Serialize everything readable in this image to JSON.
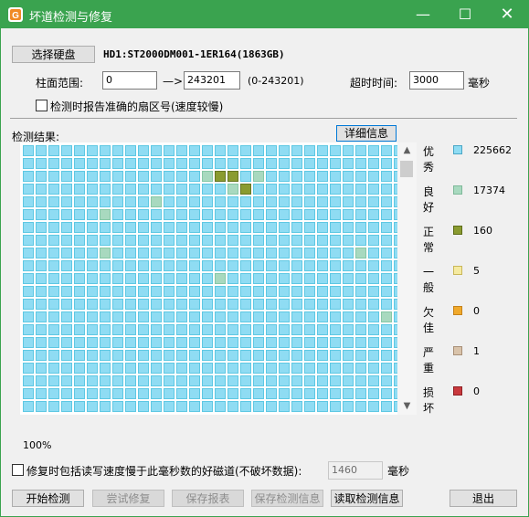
{
  "window": {
    "title": "坏道检测与修复",
    "minimize": "—",
    "maximize": "☐",
    "close": "✕"
  },
  "select_disk_button": "选择硬盘",
  "disk_info": "HD1:ST2000DM001-1ER164(1863GB)",
  "range": {
    "label": "柱面范围:",
    "start": "0",
    "arrow": "—>",
    "end": "243201",
    "hint": "(0-243201)"
  },
  "timeout": {
    "label": "超时时间:",
    "value": "3000",
    "unit": "毫秒"
  },
  "report_sector_checkbox": "检测时报告准确的扇区号(速度较慢)",
  "results_label": "检测结果:",
  "details_button": "详细信息",
  "legend": [
    {
      "label": "优秀",
      "count": "225662",
      "color": "#8fdcf3"
    },
    {
      "label": "良好",
      "count": "17374",
      "color": "#a8d9bf"
    },
    {
      "label": "正常",
      "count": "160",
      "color": "#8a9b30"
    },
    {
      "label": "一般",
      "count": "5",
      "color": "#f5eaa0"
    },
    {
      "label": "欠佳",
      "count": "0",
      "color": "#f0a92b"
    },
    {
      "label": "严重",
      "count": "1",
      "color": "#d9c3aa"
    },
    {
      "label": "损坏",
      "count": "0",
      "color": "#c9393d"
    }
  ],
  "grid": {
    "rows": 21,
    "cols": 30,
    "base_color": "#8fdcf3",
    "special": [
      {
        "r": 2,
        "c": 15,
        "type": "normal"
      },
      {
        "r": 2,
        "c": 16,
        "type": "normal"
      },
      {
        "r": 3,
        "c": 17,
        "type": "normal"
      },
      {
        "r": 2,
        "c": 14,
        "type": "good"
      },
      {
        "r": 2,
        "c": 18,
        "type": "good"
      },
      {
        "r": 3,
        "c": 16,
        "type": "good"
      },
      {
        "r": 4,
        "c": 10,
        "type": "good"
      },
      {
        "r": 5,
        "c": 6,
        "type": "good"
      },
      {
        "r": 8,
        "c": 6,
        "type": "good"
      },
      {
        "r": 8,
        "c": 26,
        "type": "good"
      },
      {
        "r": 10,
        "c": 15,
        "type": "good"
      },
      {
        "r": 13,
        "c": 28,
        "type": "good"
      }
    ]
  },
  "progress": "100%",
  "repair_checkbox": "修复时包括读写速度慢于此毫秒数的好磁道(不破坏数据):",
  "repair_threshold": "1460",
  "repair_unit": "毫秒",
  "buttons": {
    "start": "开始检测",
    "try_repair": "尝试修复",
    "save_report": "保存报表",
    "save_result": "保存检测信息",
    "load_result": "读取检测信息",
    "exit": "退出"
  }
}
